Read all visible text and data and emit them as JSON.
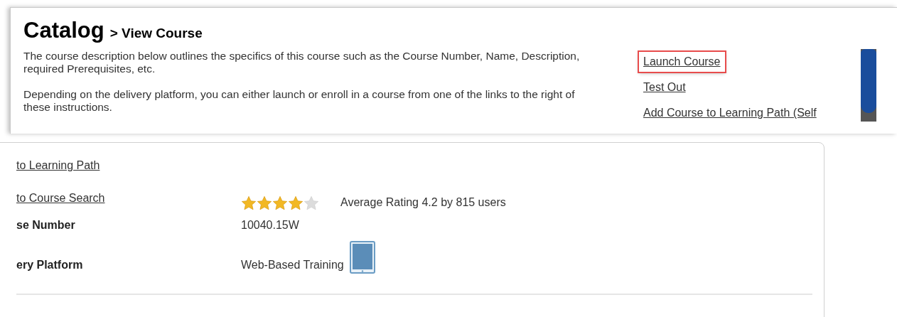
{
  "header": {
    "title": "Catalog",
    "subtitle": "> View Course"
  },
  "instructions": [
    "The course description below outlines the specifics of this course such as the Course Number, Name, Description, required Prerequisites, etc.",
    "Depending on the delivery platform, you can either launch or enroll in a course from one of the links to the right of these instructions."
  ],
  "actions": [
    {
      "label": "Launch Course",
      "highlighted": true
    },
    {
      "label": "Test Out",
      "highlighted": false
    },
    {
      "label": "Add Course to Learning Path (Self",
      "highlighted": false
    }
  ],
  "course": {
    "links": [
      "to Learning Path",
      "to Course Search"
    ],
    "rating": {
      "stars": 4,
      "text": "Average Rating 4.2 by 815 users"
    },
    "fields": [
      {
        "label": "se Number",
        "value": "10040.15W",
        "kind": "text"
      },
      {
        "label": "ery Platform",
        "value": "Web-Based Training",
        "kind": "platform"
      }
    ]
  }
}
